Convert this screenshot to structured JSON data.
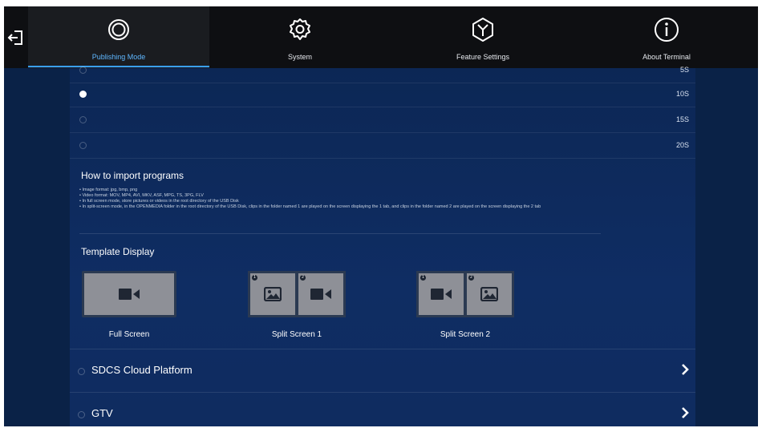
{
  "nav": {
    "tabs": [
      {
        "label": "Publishing Mode",
        "icon": "publishing-mode-icon",
        "active": true
      },
      {
        "label": "System",
        "icon": "gear-icon",
        "active": false
      },
      {
        "label": "Feature Settings",
        "icon": "feature-settings-icon",
        "active": false
      },
      {
        "label": "About Terminal",
        "icon": "info-icon",
        "active": false
      }
    ],
    "exit_icon": "exit-icon"
  },
  "speed_options": [
    {
      "value": "5S",
      "checked": false
    },
    {
      "value": "10S",
      "checked": true
    },
    {
      "value": "15S",
      "checked": false
    },
    {
      "value": "20S",
      "checked": false
    }
  ],
  "import": {
    "title": "How to import programs",
    "notes": [
      "• Image format: jpg, bmp, png",
      "• Video format: MOV, MP4, AVI, MKV, ASF, MPG, TS, 3PG, FLV",
      "• In full screen mode, store pictures or videos in the root directory of the USB Disk",
      "• In split-screen mode, in the OPENMEDIA folder in the root directory of the USB Disk, clips in the folder named 1 are played on the screen displaying the 1 tab, and clips in the folder named 2 are played on the screen displaying the 2 tab"
    ]
  },
  "template": {
    "title": "Template Display",
    "options": [
      {
        "label": "Full Screen"
      },
      {
        "label": "Split Screen 1"
      },
      {
        "label": "Split Screen 2"
      }
    ],
    "badges": [
      "1",
      "2"
    ]
  },
  "menu": [
    {
      "label": "SDCS Cloud Platform"
    },
    {
      "label": "GTV"
    }
  ],
  "colors": {
    "accent": "#3aa0ff",
    "panel": "#0f2d63",
    "topbar": "#0e0f12",
    "template_tile": "#8e9097"
  }
}
